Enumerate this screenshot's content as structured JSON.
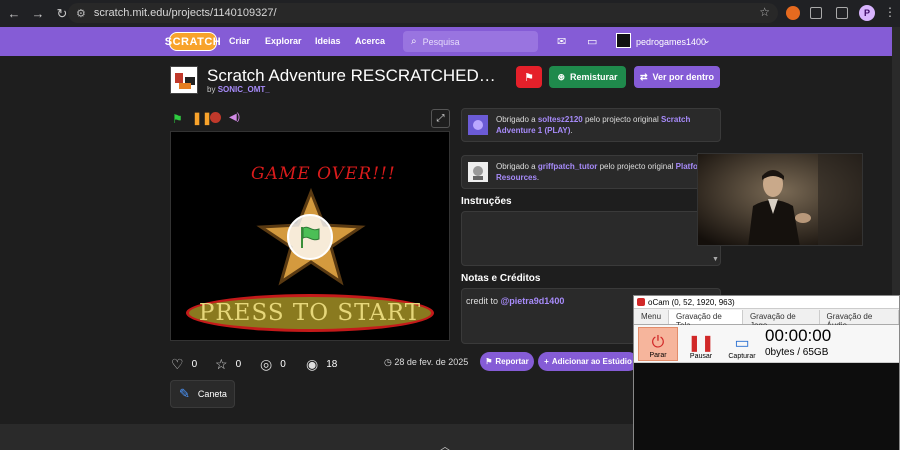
{
  "browser": {
    "url": "scratch.mit.edu/projects/1140109327/",
    "profile_initial": "P"
  },
  "nav": {
    "logo": "SCRATCH",
    "links": [
      "Criar",
      "Explorar",
      "Ideias",
      "Acerca"
    ],
    "search_placeholder": "Pesquisa",
    "username": "pedrogames1400"
  },
  "project": {
    "title": "Scratch Adventure RESCRATCHED…",
    "by_prefix": "by",
    "author": "SONIC_OMT_",
    "remix_label": "Remisturar",
    "see_inside_label": "Ver por dentro"
  },
  "stage": {
    "game_over": "GAME OVER!!!",
    "press_start": "PRESS TO START"
  },
  "credits": [
    {
      "prefix": "Obrigado a ",
      "user": "soltesz2120",
      "middle": " pelo projecto original ",
      "project": "Scratch Adventure 1 (PLAY)",
      "suffix": "."
    },
    {
      "prefix": "Obrigado a ",
      "user": "griffpatch_tutor",
      "middle": " pelo projecto original ",
      "project": "Platformer Resources",
      "suffix": "."
    }
  ],
  "instructions": {
    "title": "Instruções"
  },
  "notes": {
    "title": "Notas e Créditos",
    "text": "credit to ",
    "mention": "@pietra9d1400"
  },
  "stats": {
    "loves": "0",
    "favorites": "0",
    "remixes": "0",
    "views": "18"
  },
  "date": "28 de fev. de 2025",
  "report_label": "Reportar",
  "studio_label": "Adicionar ao Estúdio",
  "extension_tag": "Caneta",
  "ocam": {
    "title": "oCam (0, 52, 1920, 963)",
    "tabs": [
      "Menu",
      "Gravação de Tela",
      "Gravação de Jogo",
      "Gravação de Áudio"
    ],
    "buttons": [
      "Parar",
      "Pausar",
      "Capturar"
    ],
    "time": "00:00:00",
    "size": "0bytes / 65GB"
  },
  "colors": {
    "scratch_purple": "#855cd6",
    "remix_green": "#1f8a4c",
    "report_red": "#e5202a"
  }
}
